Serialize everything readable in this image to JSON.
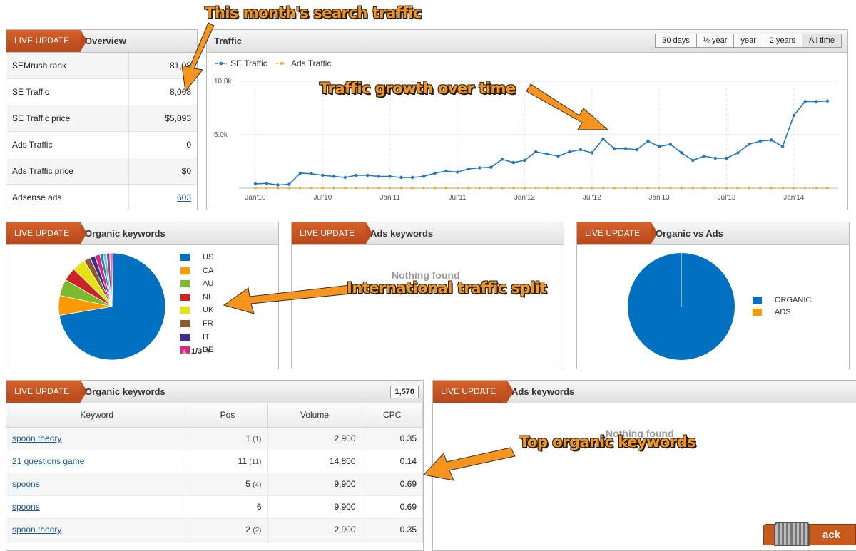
{
  "overview": {
    "badge": "LIVE UPDATE",
    "title": "Overview",
    "rows": [
      {
        "label": "SEMrush rank",
        "value": "81,08"
      },
      {
        "label": "SE Traffic",
        "value": "8,068"
      },
      {
        "label": "SE Traffic price",
        "value": "$5,093"
      },
      {
        "label": "Ads Traffic",
        "value": "0"
      },
      {
        "label": "Ads Traffic price",
        "value": "$0"
      },
      {
        "label": "Adsense ads",
        "value": "603"
      }
    ]
  },
  "traffic": {
    "title": "Traffic",
    "ranges": [
      "30 days",
      "½ year",
      "year",
      "2 years",
      "All time"
    ],
    "selected_range": "All time"
  },
  "chart_data": {
    "type": "line",
    "ylabels": [
      "10.0k",
      "5.0k"
    ],
    "ylim": [
      0,
      10000
    ],
    "xticks": [
      "Jan'10",
      "Jul'10",
      "Jan'11",
      "Jul'11",
      "Jan'12",
      "Jul'12",
      "Jan'13",
      "Jul'13",
      "Jan'14"
    ],
    "grid": true,
    "legend_position": "top-left",
    "series": [
      {
        "name": "SE Traffic",
        "color": "#1f77c4",
        "values": [
          400,
          450,
          300,
          350,
          1400,
          1350,
          1200,
          1100,
          1000,
          1200,
          1200,
          1100,
          1100,
          1000,
          1000,
          1100,
          1400,
          1600,
          1500,
          1800,
          1900,
          1950,
          2700,
          2400,
          2600,
          3400,
          3200,
          3000,
          3400,
          3600,
          3300,
          4600,
          3700,
          3700,
          3600,
          4400,
          3900,
          4100,
          3300,
          2600,
          3000,
          2800,
          2800,
          3300,
          4100,
          4400,
          4500,
          3900,
          6800,
          8100,
          8100,
          8150
        ]
      },
      {
        "name": "Ads Traffic",
        "color": "#f5a623",
        "values": [
          0,
          0,
          0,
          0,
          0,
          0,
          0,
          0,
          0,
          0,
          0,
          0,
          0,
          0,
          0,
          0,
          0,
          0,
          0,
          0,
          0,
          0,
          0,
          0,
          0,
          0,
          0,
          0,
          0,
          0,
          0,
          0,
          0,
          0,
          0,
          0,
          0,
          0,
          0,
          0,
          0,
          0,
          0,
          0,
          0,
          0,
          0,
          0,
          0,
          0,
          0,
          0
        ]
      }
    ]
  },
  "organic_pie": {
    "badge": "LIVE UPDATE",
    "title": "Organic keywords",
    "legend": [
      {
        "label": "US",
        "color": "#0070c0"
      },
      {
        "label": "CA",
        "color": "#ff9900"
      },
      {
        "label": "AU",
        "color": "#7dbb2e"
      },
      {
        "label": "NL",
        "color": "#cc2229"
      },
      {
        "label": "UK",
        "color": "#e3e312"
      },
      {
        "label": "FR",
        "color": "#8c5a2b"
      },
      {
        "label": "IT",
        "color": "#3a2f8f"
      },
      {
        "label": "DE",
        "color": "#e52380"
      }
    ],
    "slices": [
      72,
      6,
      5,
      4,
      4,
      2,
      1.5,
      1.5,
      1,
      1,
      1,
      1
    ],
    "extra_colors": [
      "#00a0a0",
      "#a0a0ff",
      "#666666",
      "#ff66cc"
    ],
    "pager": "1/3"
  },
  "ads_keywords_top": {
    "badge": "LIVE UPDATE",
    "title": "Ads keywords",
    "empty": "Nothing found"
  },
  "organic_vs_ads": {
    "badge": "LIVE UPDATE",
    "title": "Organic vs Ads",
    "legend": [
      {
        "label": "ORGANIC",
        "color": "#0070c0"
      },
      {
        "label": "ADS",
        "color": "#ff9900"
      }
    ]
  },
  "keywords_table": {
    "badge": "LIVE UPDATE",
    "title": "Organic keywords",
    "count": "1,570",
    "headers": [
      "Keyword",
      "Pos",
      "Volume",
      "CPC"
    ],
    "rows": [
      {
        "keyword": "spoon theory",
        "pos": "1",
        "prev": "(1)",
        "volume": "2,900",
        "cpc": "0.35"
      },
      {
        "keyword": "21 questions game",
        "pos": "11",
        "prev": "(11)",
        "volume": "14,800",
        "cpc": "0.14"
      },
      {
        "keyword": "spoons",
        "pos": "5",
        "prev": "(4)",
        "volume": "9,900",
        "cpc": "0.69"
      },
      {
        "keyword": "spoons",
        "pos": "6",
        "prev": "",
        "volume": "9,900",
        "cpc": "0.69"
      },
      {
        "keyword": "spoon theory",
        "pos": "2",
        "prev": "(2)",
        "volume": "2,900",
        "cpc": "0.35"
      }
    ]
  },
  "ads_keywords_bottom": {
    "badge": "LIVE UPDATE",
    "title": "Ads keywords",
    "empty": "Nothing found"
  },
  "feedback": {
    "label": "ack"
  },
  "annotations": {
    "a1": "This month's search traffic",
    "a2": "Traffic growth over time",
    "a3": "International traffic split",
    "a4": "Top organic keywords"
  }
}
